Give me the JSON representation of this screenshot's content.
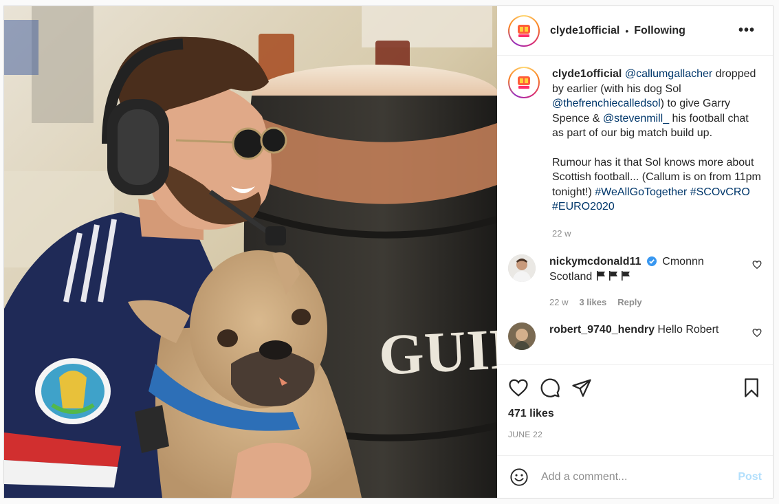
{
  "header": {
    "username": "clyde1official",
    "separator": "•",
    "follow_state": "Following",
    "more_label": "•••"
  },
  "photo": {
    "barrel_text": "GUIN"
  },
  "caption": {
    "username": "clyde1official",
    "parts": [
      {
        "text": "@callumgallacher",
        "link": true
      },
      {
        "text": " dropped by earlier (with his dog Sol ",
        "link": false
      },
      {
        "text": "@thefrenchiecalledsol",
        "link": true
      },
      {
        "text": ") to give Garry Spence & ",
        "link": false
      },
      {
        "text": "@stevenmill_",
        "link": true
      },
      {
        "text": " his football chat as part of our big match build up.",
        "link": false
      }
    ],
    "paragraph2": "Rumour has it that Sol knows more about Scottish football... (Callum is on from 11pm tonight!)",
    "hashtags": [
      "#WeAllGoTogether",
      "#SCOvCRO",
      "#EURO2020"
    ],
    "time": "22 w"
  },
  "comments": [
    {
      "username": "nickymcdonald11",
      "verified": true,
      "text": "Cmonnn Scotland",
      "flags": 3,
      "time": "22 w",
      "likes": "3 likes",
      "reply": "Reply"
    },
    {
      "username": "robert_9740_hendry",
      "verified": false,
      "text": "Hello Robert"
    }
  ],
  "actions": {
    "likes": "471 likes",
    "date": "JUNE 22"
  },
  "add_comment": {
    "placeholder": "Add a comment...",
    "post_label": "Post"
  },
  "colors": {
    "link": "#00376b",
    "muted": "#8e8e8e",
    "post_disabled": "#b2dffc",
    "verified": "#3897f0"
  }
}
